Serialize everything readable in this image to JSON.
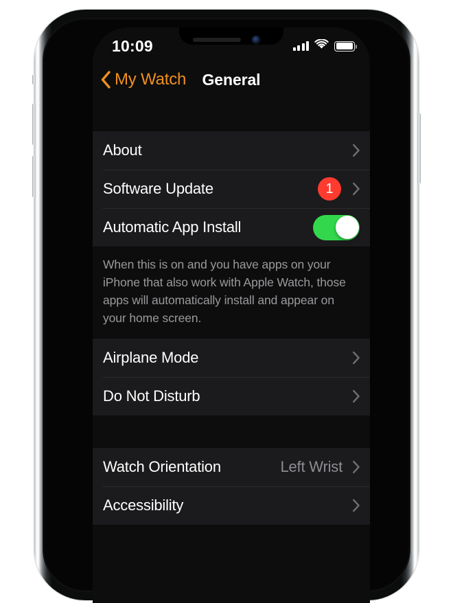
{
  "status_bar": {
    "time": "10:09",
    "cellular_icon": "signal-bars-icon",
    "cellular_bars": 4,
    "wifi_icon": "wifi-icon",
    "battery_icon": "battery-icon",
    "battery_level": 100
  },
  "nav_bar": {
    "back_icon": "chevron-left-icon",
    "back_label": "My Watch",
    "title": "General"
  },
  "sections": [
    {
      "name": "general-primary",
      "rows": [
        {
          "label": "About",
          "accessory": "chevron",
          "value": null
        },
        {
          "label": "Software Update",
          "accessory": "badge-chevron",
          "badge": "1",
          "value": null
        },
        {
          "label": "Automatic App Install",
          "accessory": "toggle",
          "toggle_on": true,
          "value": null
        }
      ],
      "footer": "When this is on and you have apps on your iPhone that also work with Apple Watch, those apps will automatically install and appear on your home screen."
    },
    {
      "name": "connectivity",
      "rows": [
        {
          "label": "Airplane Mode",
          "accessory": "chevron",
          "value": null
        },
        {
          "label": "Do Not Disturb",
          "accessory": "chevron",
          "value": null
        }
      ],
      "footer": null
    },
    {
      "name": "device-options",
      "rows": [
        {
          "label": "Watch Orientation",
          "accessory": "chevron",
          "value": "Left Wrist"
        },
        {
          "label": "Accessibility",
          "accessory": "chevron",
          "value": null
        }
      ],
      "footer": null
    }
  ],
  "colors": {
    "accent_orange": "#F0901E",
    "badge_red": "#FF3B30",
    "toggle_green": "#32D74B",
    "row_background": "#1b1b1d",
    "screen_background": "#0d0d0d",
    "secondary_text": "#8d8d92"
  }
}
